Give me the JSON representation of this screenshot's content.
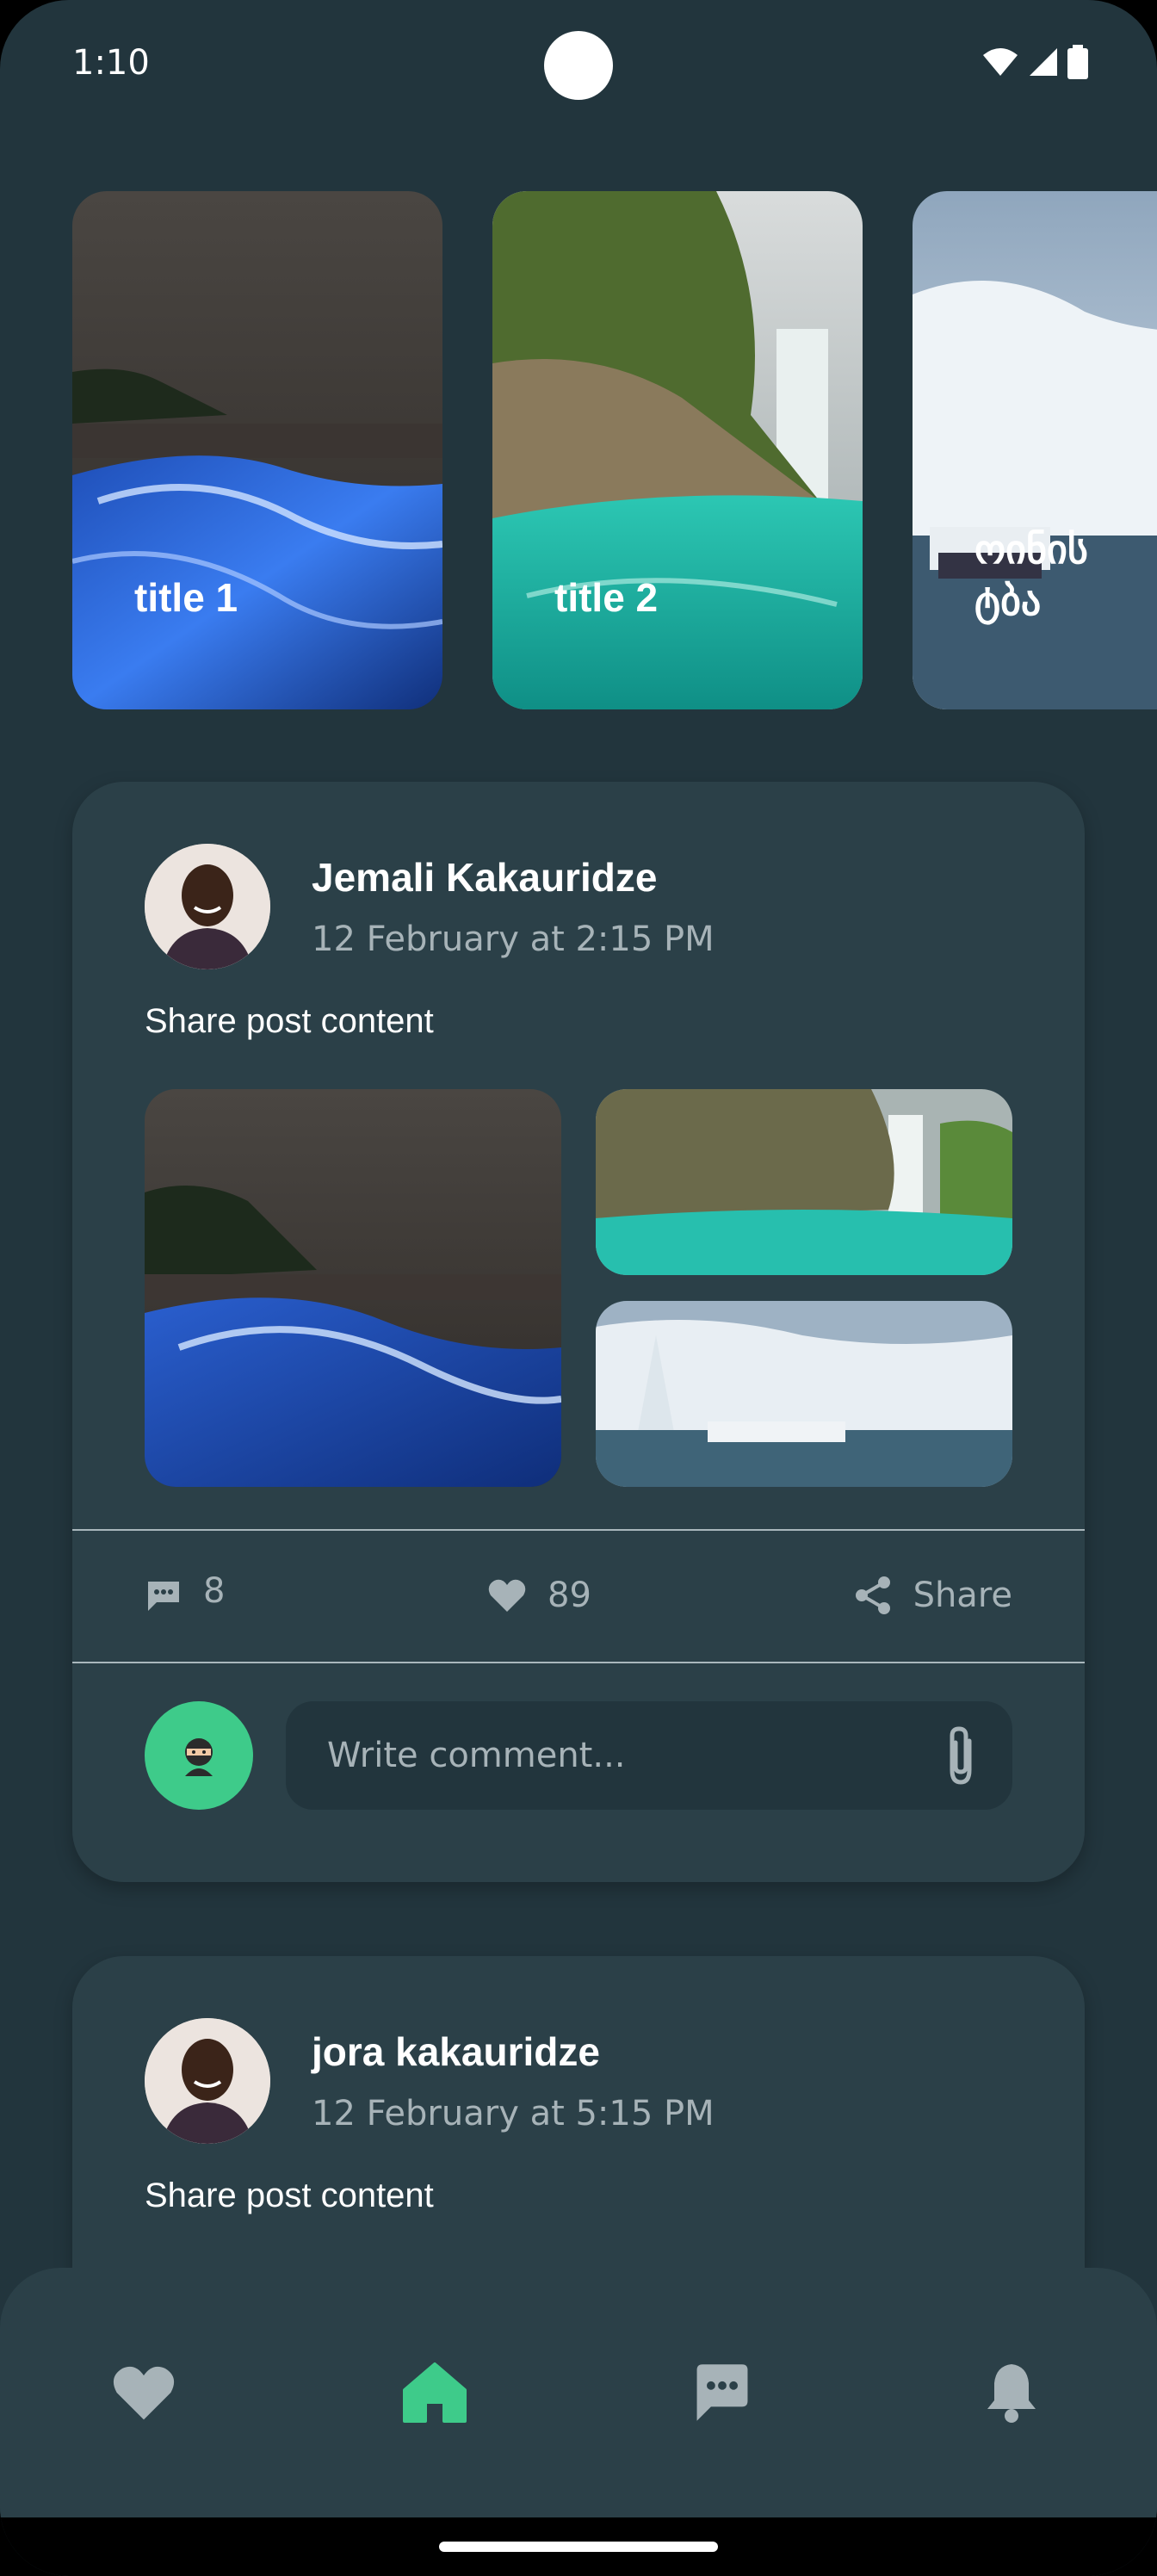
{
  "status_bar": {
    "time": "1:10"
  },
  "stories": [
    {
      "title": "title 1"
    },
    {
      "title": "title 2"
    },
    {
      "title": "ოინის ტბა"
    }
  ],
  "posts": [
    {
      "author": "Jemali Kakauridze",
      "date": "12 February at 2:15 PM",
      "content": "Share post content",
      "comments_count": "8",
      "likes_count": "89",
      "share_label": "Share",
      "comment_placeholder": "Write comment..."
    },
    {
      "author": "jora kakauridze",
      "date": "12 February at 5:15 PM",
      "content": "Share post content"
    }
  ],
  "nav": {
    "items": [
      "favorites",
      "home",
      "messages",
      "notifications"
    ],
    "active": "home"
  },
  "colors": {
    "background": "#22353d",
    "card": "#2b4048",
    "accent": "#3ecb8a",
    "muted_text": "#a7b3b8"
  }
}
